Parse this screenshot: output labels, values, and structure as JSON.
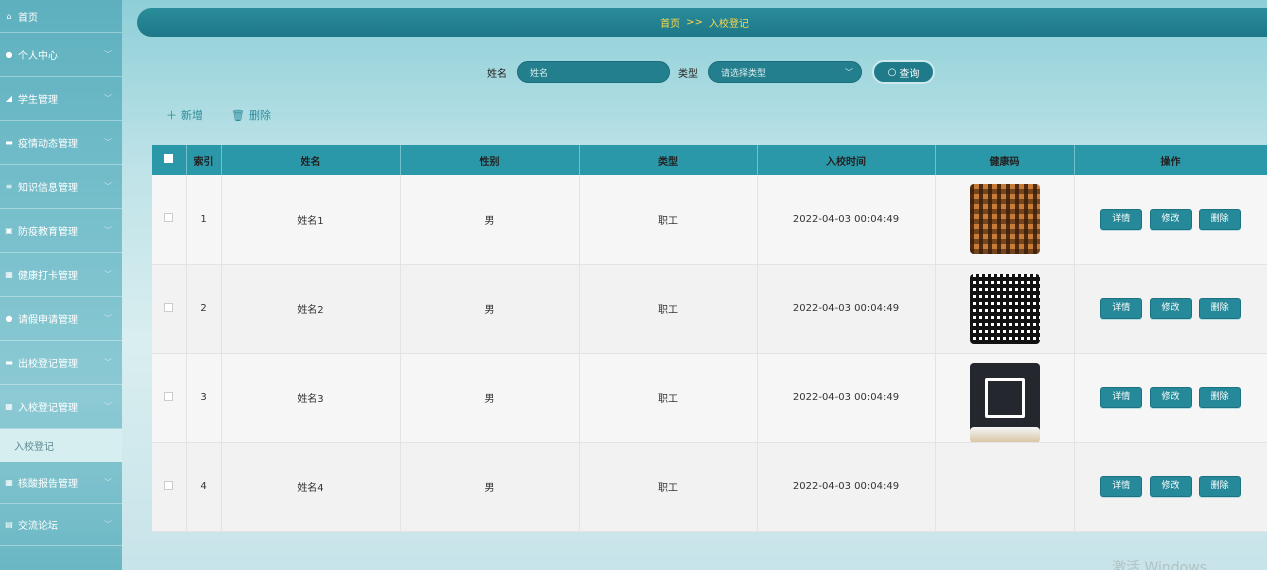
{
  "sidebar": {
    "items": [
      {
        "icon": "home-icon",
        "label": "首页"
      },
      {
        "icon": "user-icon",
        "label": "个人中心"
      },
      {
        "icon": "student-icon",
        "label": "学生管理"
      },
      {
        "icon": "chat-icon",
        "label": "疫情动态管理"
      },
      {
        "icon": "list-icon",
        "label": "知识信息管理"
      },
      {
        "icon": "doc-icon",
        "label": "防疫教育管理"
      },
      {
        "icon": "grid-icon",
        "label": "健康打卡管理"
      },
      {
        "icon": "user-icon",
        "label": "请假申请管理"
      },
      {
        "icon": "chat-icon",
        "label": "出校登记管理"
      },
      {
        "icon": "grid-icon",
        "label": "入校登记管理"
      },
      {
        "icon": "grid-icon",
        "label": "核酸报告管理"
      },
      {
        "icon": "forum-icon",
        "label": "交流论坛"
      }
    ],
    "active_sub": "入校登记"
  },
  "breadcrumb": {
    "home": "首页",
    "sep": ">>",
    "current": "入校登记"
  },
  "search": {
    "name_label": "姓名",
    "name_placeholder": "姓名",
    "type_label": "类型",
    "type_placeholder": "请选择类型",
    "button": "查询"
  },
  "actions": {
    "add": "新增",
    "delete": "删除"
  },
  "table": {
    "headers": [
      "索引",
      "姓名",
      "性别",
      "类型",
      "入校时间",
      "健康码",
      "操作"
    ],
    "rows": [
      {
        "index": "1",
        "name": "姓名1",
        "gender": "男",
        "type": "职工",
        "time": "2022-04-03 00:04:49"
      },
      {
        "index": "2",
        "name": "姓名2",
        "gender": "男",
        "type": "职工",
        "time": "2022-04-03 00:04:49"
      },
      {
        "index": "3",
        "name": "姓名3",
        "gender": "男",
        "type": "职工",
        "time": "2022-04-03 00:04:49"
      },
      {
        "index": "4",
        "name": "姓名4",
        "gender": "男",
        "type": "职工",
        "time": "2022-04-03 00:04:49"
      }
    ],
    "row_buttons": {
      "detail": "详情",
      "edit": "修改",
      "delete": "删除"
    }
  },
  "watermark": "激活 Windows"
}
